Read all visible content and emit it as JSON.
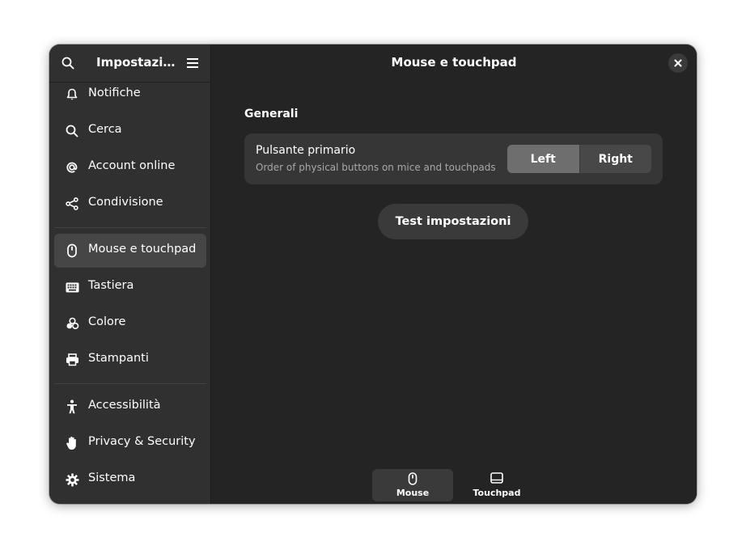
{
  "sidebar": {
    "title": "Impostazi…",
    "items": [
      {
        "label": "Notifiche",
        "icon": "bell-icon"
      },
      {
        "label": "Cerca",
        "icon": "search-icon"
      },
      {
        "label": "Account online",
        "icon": "at-icon"
      },
      {
        "label": "Condivisione",
        "icon": "share-icon"
      },
      {
        "label": "Mouse e touchpad",
        "icon": "mouse-icon"
      },
      {
        "label": "Tastiera",
        "icon": "keyboard-icon"
      },
      {
        "label": "Colore",
        "icon": "color-icon"
      },
      {
        "label": "Stampanti",
        "icon": "printer-icon"
      },
      {
        "label": "Accessibilità",
        "icon": "accessibility-icon"
      },
      {
        "label": "Privacy & Security",
        "icon": "hand-icon"
      },
      {
        "label": "Sistema",
        "icon": "gear-icon"
      }
    ],
    "active_index": 4
  },
  "content": {
    "title": "Mouse e touchpad",
    "group_title": "Generali",
    "primary_button": {
      "title": "Pulsante primario",
      "subtitle": "Order of physical buttons on mice and touchpads",
      "options": [
        "Left",
        "Right"
      ],
      "selected": "Left"
    },
    "test_button": "Test impostazioni"
  },
  "view_switcher": {
    "items": [
      {
        "label": "Mouse",
        "icon": "mouse-icon",
        "active": true
      },
      {
        "label": "Touchpad",
        "icon": "touchpad-icon",
        "active": false
      }
    ]
  },
  "colors": {
    "window_bg": "#242424",
    "sidebar_bg": "#303030",
    "active_item": "#464646",
    "card_bg": "#363636"
  }
}
